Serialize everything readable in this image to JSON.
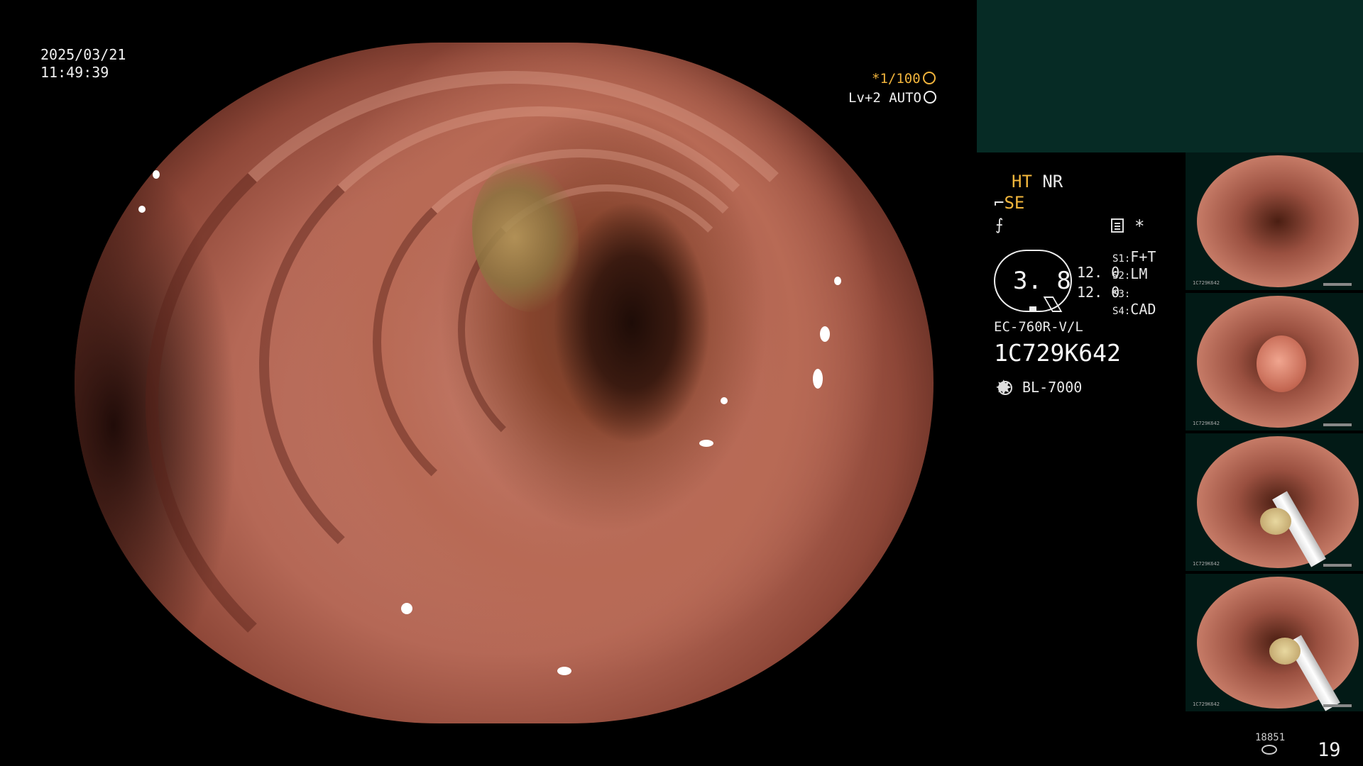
{
  "overlay": {
    "date": "2025/03/21",
    "time": "11:49:39",
    "shutter": "*1/100",
    "level": "Lv+2 AUTO"
  },
  "panel": {
    "mode_ht": "HT",
    "mode_nr": "NR",
    "se_label": "SE",
    "gauge_value": "3. 8",
    "val1": "12. 0",
    "val2": "12. 0",
    "s1_label": "S1:",
    "s1_value": "F+T",
    "s2_label": "S2:",
    "s2_value": "LM",
    "s3_label": "S3:",
    "s3_value": "",
    "s4_label": "S4:",
    "s4_value": "CAD",
    "scope_model": "EC-760R-V/L",
    "scope_serial": "1C729K642",
    "light_source": "BL-7000"
  },
  "thumbnails": [
    {
      "caption": "1C729K642"
    },
    {
      "caption": "1C729K642"
    },
    {
      "caption": "1C729K642"
    },
    {
      "caption": "1C729K642"
    }
  ],
  "footer": {
    "image_count_small": "18851",
    "image_count": "19"
  },
  "icons": [
    "shutter-icon",
    "auto-icon",
    "wave-icon",
    "document-icon",
    "star-icon",
    "light-source-icon",
    "storage-icon"
  ],
  "colors": {
    "accent": "#f3b73c",
    "panel_bg": "#062b25"
  }
}
